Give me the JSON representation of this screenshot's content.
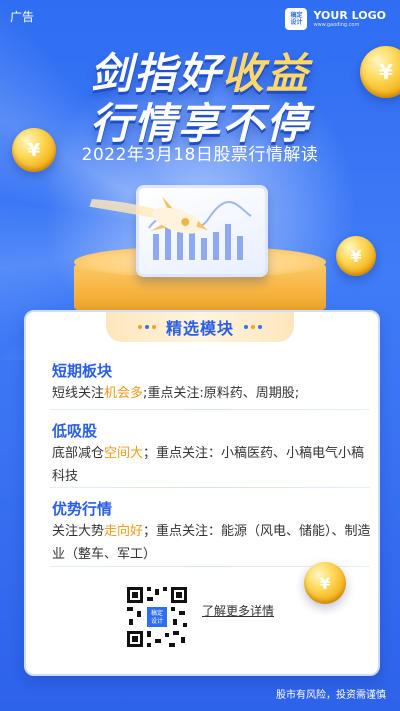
{
  "ad_tag": "广告",
  "logo": {
    "badge_line1": "稿定",
    "badge_line2": "设计",
    "text": "YOUR LOGO",
    "sub": "www.gaoding.com"
  },
  "headline": {
    "line1_part1": "剑指好",
    "line1_accent": "收益",
    "line2": "行情享不停"
  },
  "subtitle": "2022年3月18日股票行情解读",
  "coin_symbol": "¥",
  "card": {
    "header": "精选模块",
    "sections": [
      {
        "title": "短期板块",
        "body_pre": "短线关注",
        "body_highlight": "机会多",
        "body_post": ";重点关注:原料药、周期股;"
      },
      {
        "title": "低吸股",
        "body_pre": "底部减仓",
        "body_highlight": "空间大",
        "body_post": "；重点关注：小稿医药、小稿电气小稿科技"
      },
      {
        "title": "优势行情",
        "body_pre": "关注大势",
        "body_highlight": "走向好",
        "body_post": "；重点关注：能源（风电、储能）、制造业（整车、军工）"
      }
    ]
  },
  "qr_center_line1": "稿定",
  "qr_center_line2": "设计",
  "more_link": "了解更多详情",
  "risk_notice": "股市有风险，投资需谨慎",
  "colors": {
    "background": "#2f6df2",
    "accent_blue": "#2a5ee6",
    "highlight_orange": "#f19a18",
    "gold": "#ffd86a"
  }
}
